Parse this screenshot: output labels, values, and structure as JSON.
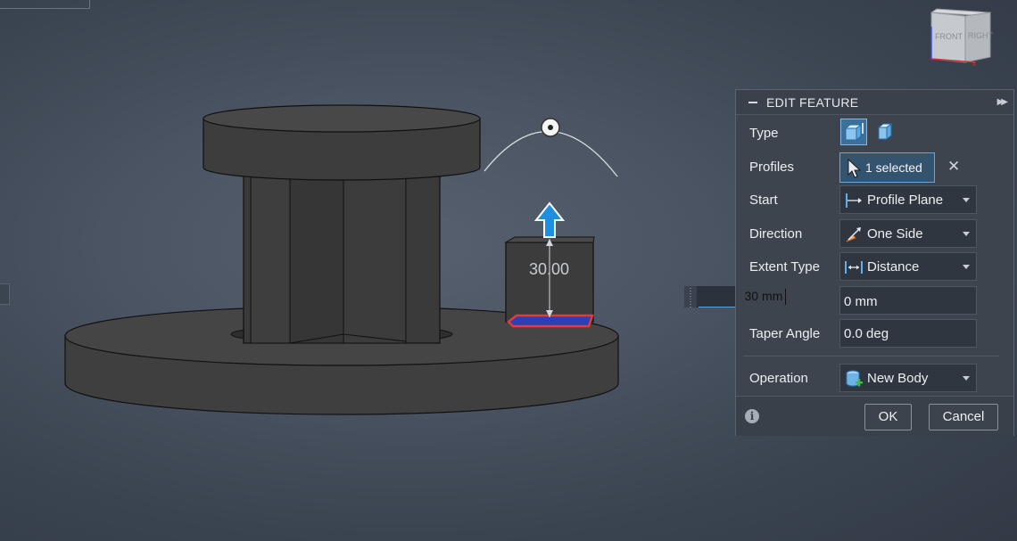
{
  "viewport": {
    "dimension_value": "30.00",
    "viewcube": {
      "front_label": "FRONT",
      "right_label": "RIGHT"
    }
  },
  "floating_input": {
    "value": "30 mm"
  },
  "panel": {
    "title": "EDIT FEATURE",
    "type": {
      "label": "Type",
      "selected": "extrude-solid"
    },
    "profiles": {
      "label": "Profiles",
      "value": "1 selected"
    },
    "start": {
      "label": "Start",
      "value": "Profile Plane"
    },
    "direction": {
      "label": "Direction",
      "value": "One Side"
    },
    "extent_type": {
      "label": "Extent Type",
      "value": "Distance"
    },
    "distance": {
      "value": "30 mm",
      "visible_text": "0 mm"
    },
    "taper_angle": {
      "label": "Taper Angle",
      "value": "0.0 deg"
    },
    "operation": {
      "label": "Operation",
      "value": "New Body"
    },
    "buttons": {
      "ok": "OK",
      "cancel": "Cancel"
    }
  },
  "colors": {
    "accent": "#4aa3df",
    "arrow": "#1e8fe0",
    "profile_highlight": "#e23b3b",
    "body": "#3d3d3d",
    "panel_bg": "#3d444e"
  }
}
